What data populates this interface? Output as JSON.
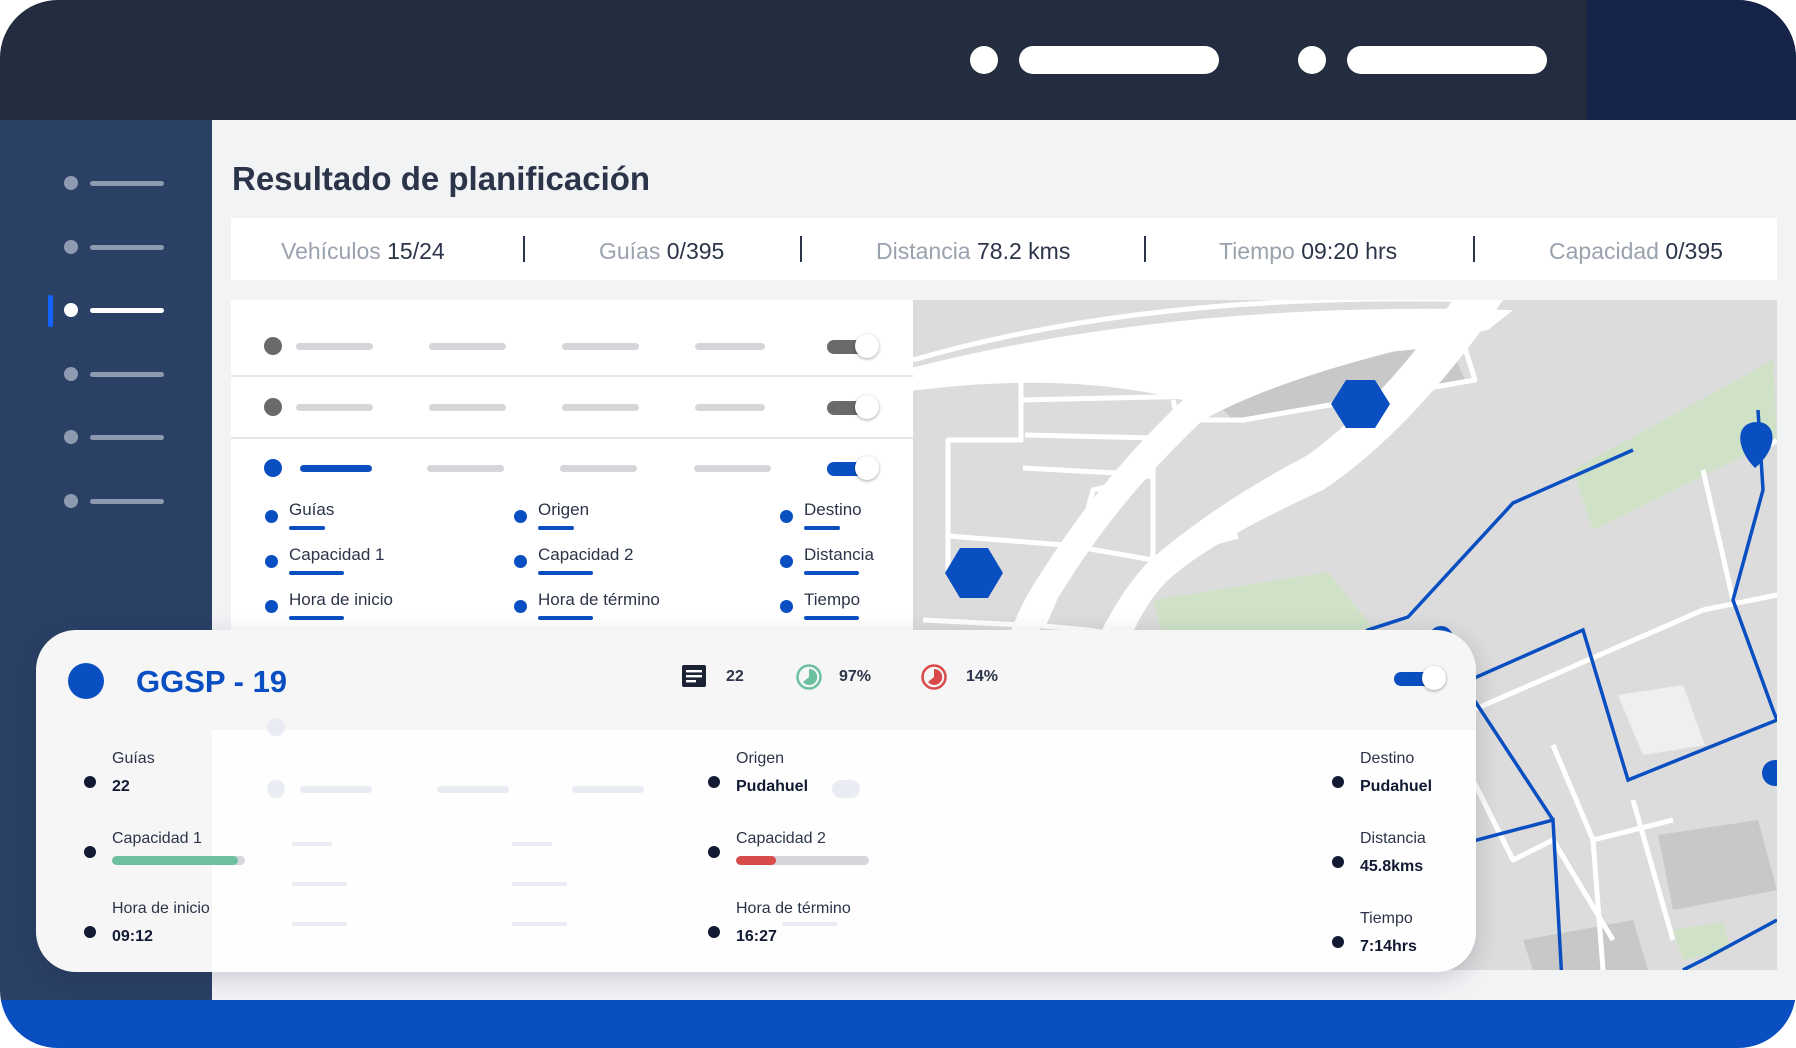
{
  "page": {
    "title": "Resultado de planificación"
  },
  "stats": [
    {
      "label": "Vehículos",
      "value": "15/24"
    },
    {
      "label": "Guías",
      "value": "0/395"
    },
    {
      "label": "Distancia",
      "value": "78.2 kms"
    },
    {
      "label": "Tiempo",
      "value": "09:20 hrs"
    },
    {
      "label": "Capacidad",
      "value": "0/395"
    }
  ],
  "sidebar": {
    "active_index": 2,
    "item_count": 6
  },
  "list": {
    "expanded_fields": [
      "Guías",
      "Origen",
      "Destino",
      "Capacidad 1",
      "Capacidad 2",
      "Distancia",
      "Hora de inicio",
      "Hora de término",
      "Tiempo"
    ]
  },
  "card": {
    "title": "GGSP - 19",
    "metrics": [
      {
        "icon": "document-list-icon",
        "value": "22"
      },
      {
        "icon": "pie-progress-green-icon",
        "value": "97%"
      },
      {
        "icon": "pie-progress-red-icon",
        "value": "14%"
      }
    ],
    "toggle_on": true,
    "fields": {
      "guias": {
        "label": "Guías",
        "value": "22"
      },
      "capacidad1": {
        "label": "Capacidad 1",
        "level": 0.95,
        "color": "#6cc0a0"
      },
      "hora_inicio": {
        "label": "Hora de inicio",
        "value": "09:12"
      },
      "origen": {
        "label": "Origen",
        "value": "Pudahuel"
      },
      "capacidad2": {
        "label": "Capacidad 2",
        "level": 0.3,
        "color": "#d94a4a"
      },
      "hora_termino": {
        "label": "Hora de término",
        "value": "16:27"
      },
      "destino": {
        "label": "Destino",
        "value": "Pudahuel"
      },
      "distancia": {
        "label": "Distancia",
        "value": "45.8kms"
      },
      "tiempo": {
        "label": "Tiempo",
        "value": "7:14hrs"
      }
    }
  },
  "colors": {
    "accent": "#0a4fc2",
    "topbar": "#232d3f",
    "sidebar": "#2a4065",
    "green": "#6cc0a0",
    "red": "#d94a4a"
  }
}
